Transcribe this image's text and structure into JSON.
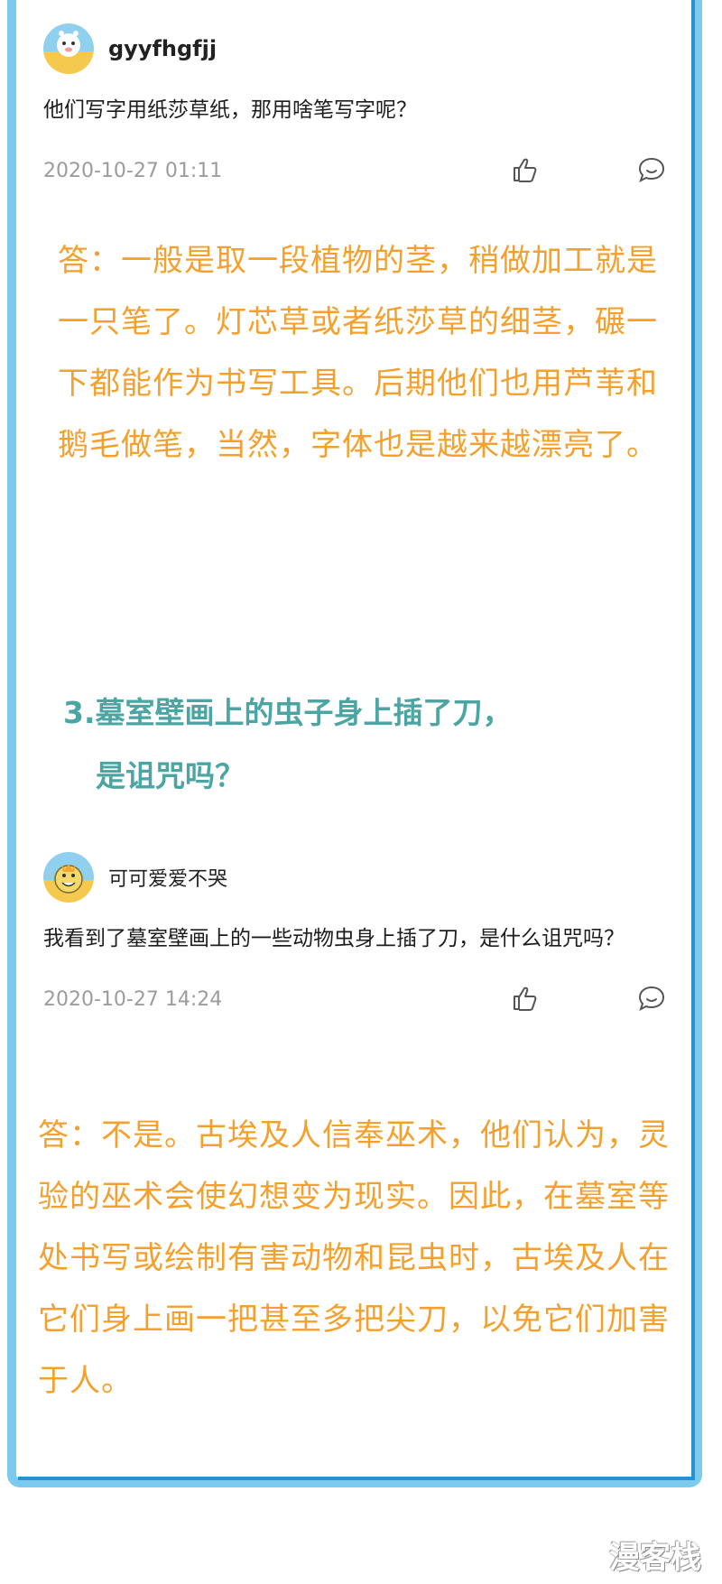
{
  "comment1": {
    "username": "gyyfhgfjj",
    "question": "他们写字用纸莎草纸，那用啥笔写字呢？",
    "timestamp": "2020-10-27 01:11",
    "answer": "答：一般是取一段植物的茎，稍做加工就是一只笔了。灯芯草或者纸莎草的细茎，碾一下都能作为书写工具。后期他们也用芦苇和鹅毛做笔，当然，字体也是越来越漂亮了。"
  },
  "section3": {
    "line1": "3.墓室壁画上的虫子身上插了刀，",
    "line2": "是诅咒吗？"
  },
  "comment2": {
    "username": "可可爱爱不哭",
    "question": "我看到了墓室壁画上的一些动物虫身上插了刀，是什么诅咒吗？",
    "timestamp": "2020-10-27 14:24",
    "answer": "答：不是。古埃及人信奉巫术，他们认为，灵验的巫术会使幻想变为现实。因此，在墓室等处书写或绘制有害动物和昆虫时，古埃及人在它们身上画一把甚至多把尖刀，以免它们加害于人。"
  },
  "icons": {
    "like": "thumbs-up-icon",
    "reply": "comment-bubble-icon"
  },
  "colors": {
    "frame": "#7ccbee",
    "answer_text": "#f5a02c",
    "section_title": "#4aa5a3",
    "timestamp": "#9c9c9c"
  },
  "watermark": "漫客栈"
}
